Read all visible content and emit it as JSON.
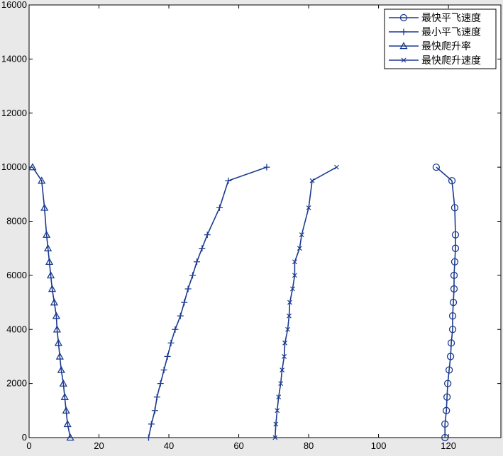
{
  "chart_data": {
    "type": "line",
    "title": "",
    "xlabel": "",
    "ylabel": "",
    "xlim": [
      0,
      135
    ],
    "ylim": [
      0,
      16000
    ],
    "xticks": [
      0,
      20,
      40,
      60,
      80,
      100,
      120
    ],
    "yticks": [
      0,
      2000,
      4000,
      6000,
      8000,
      10000,
      12000,
      14000,
      16000
    ],
    "grid": false,
    "legend_position": "top-right",
    "line_color": "#1a3a8f",
    "series": [
      {
        "name": "最快平飞速度",
        "marker": "circle",
        "points": [
          [
            116.5,
            10000
          ],
          [
            121.0,
            9500
          ],
          [
            121.8,
            8500
          ],
          [
            122.0,
            7500
          ],
          [
            122.0,
            7000
          ],
          [
            121.8,
            6500
          ],
          [
            121.6,
            6000
          ],
          [
            121.6,
            5500
          ],
          [
            121.4,
            5000
          ],
          [
            121.2,
            4500
          ],
          [
            121.2,
            4000
          ],
          [
            120.8,
            3500
          ],
          [
            120.6,
            3000
          ],
          [
            120.2,
            2500
          ],
          [
            119.8,
            2000
          ],
          [
            119.6,
            1500
          ],
          [
            119.4,
            1000
          ],
          [
            119.0,
            500
          ],
          [
            119.0,
            0
          ]
        ]
      },
      {
        "name": "最小平飞速度",
        "marker": "plus",
        "points": [
          [
            68.0,
            10000
          ],
          [
            57.0,
            9500
          ],
          [
            54.5,
            8500
          ],
          [
            51.0,
            7500
          ],
          [
            49.5,
            7000
          ],
          [
            48.0,
            6500
          ],
          [
            46.8,
            6000
          ],
          [
            45.5,
            5500
          ],
          [
            44.4,
            5000
          ],
          [
            43.3,
            4500
          ],
          [
            41.8,
            4000
          ],
          [
            40.6,
            3500
          ],
          [
            39.6,
            3000
          ],
          [
            38.6,
            2500
          ],
          [
            37.6,
            2000
          ],
          [
            36.6,
            1500
          ],
          [
            36.0,
            1000
          ],
          [
            35.0,
            500
          ],
          [
            34.2,
            0
          ]
        ]
      },
      {
        "name": "最快爬升率",
        "marker": "triangle",
        "points": [
          [
            1.0,
            10000
          ],
          [
            3.6,
            9500
          ],
          [
            4.4,
            8500
          ],
          [
            5.0,
            7500
          ],
          [
            5.4,
            7000
          ],
          [
            5.8,
            6500
          ],
          [
            6.2,
            6000
          ],
          [
            6.6,
            5500
          ],
          [
            7.2,
            5000
          ],
          [
            7.8,
            4500
          ],
          [
            8.0,
            4000
          ],
          [
            8.4,
            3500
          ],
          [
            8.8,
            3000
          ],
          [
            9.2,
            2500
          ],
          [
            9.8,
            2000
          ],
          [
            10.2,
            1500
          ],
          [
            10.6,
            1000
          ],
          [
            11.0,
            500
          ],
          [
            11.8,
            0
          ]
        ]
      },
      {
        "name": "最快爬升速度",
        "marker": "x",
        "points": [
          [
            88.0,
            10000
          ],
          [
            81.0,
            9500
          ],
          [
            80.0,
            8500
          ],
          [
            78.0,
            7500
          ],
          [
            77.4,
            7000
          ],
          [
            76.0,
            6500
          ],
          [
            76.0,
            6000
          ],
          [
            75.4,
            5500
          ],
          [
            74.6,
            5000
          ],
          [
            74.4,
            4500
          ],
          [
            74.0,
            4000
          ],
          [
            73.2,
            3500
          ],
          [
            73.0,
            3000
          ],
          [
            72.4,
            2500
          ],
          [
            72.0,
            2000
          ],
          [
            71.4,
            1500
          ],
          [
            71.0,
            1000
          ],
          [
            70.6,
            500
          ],
          [
            70.4,
            0
          ]
        ]
      }
    ]
  }
}
